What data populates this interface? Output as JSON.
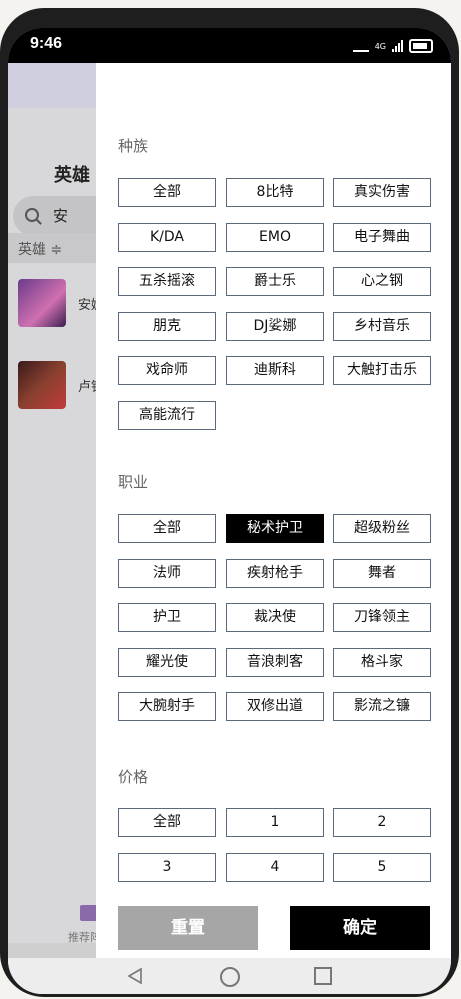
{
  "status_bar": {
    "time": "9:46",
    "network": "4G"
  },
  "background_app": {
    "title": "英雄",
    "search_value": "安",
    "sort_label": "英雄 ≑",
    "hero_names": [
      "安妮",
      "卢锡"
    ],
    "tab_label": "推荐阵"
  },
  "filter": {
    "sections": [
      {
        "title": "种族",
        "options": [
          "全部",
          "8比特",
          "真实伤害",
          "K/DA",
          "EMO",
          "电子舞曲",
          "五杀摇滚",
          "爵士乐",
          "心之钢",
          "朋克",
          "DJ娑娜",
          "乡村音乐",
          "戏命师",
          "迪斯科",
          "大触打击乐",
          "高能流行"
        ]
      },
      {
        "title": "职业",
        "options": [
          "全部",
          "秘术护卫",
          "超级粉丝",
          "法师",
          "疾射枪手",
          "舞者",
          "护卫",
          "裁决使",
          "刀锋领主",
          "耀光使",
          "音浪刺客",
          "格斗家",
          "大腕射手",
          "双修出道",
          "影流之镰"
        ],
        "selected": "秘术护卫"
      },
      {
        "title": "价格",
        "options": [
          "全部",
          "1",
          "2",
          "3",
          "4",
          "5"
        ]
      }
    ],
    "reset_label": "重置",
    "confirm_label": "确定"
  },
  "colors": {
    "selected_chip": "#000000",
    "reset_button": "#a6a6a6",
    "confirm_button": "#000000"
  }
}
